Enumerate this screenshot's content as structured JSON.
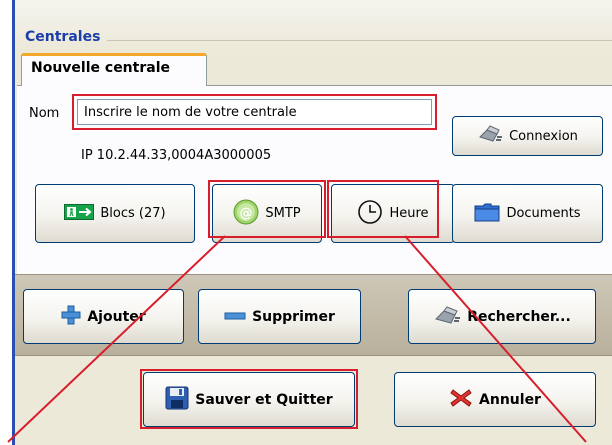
{
  "group": {
    "title": "Centrales"
  },
  "tab": {
    "label": "Nouvelle centrale"
  },
  "form": {
    "nom_label": "Nom",
    "nom_value": "Inscrire le nom de votre centrale",
    "ip_text": "IP 10.2.44.33,0004A3000005"
  },
  "buttons": {
    "connexion": "Connexion",
    "blocs": "Blocs (27)",
    "smtp": "SMTP",
    "heure": "Heure",
    "documents": "Documents",
    "ajouter": "Ajouter",
    "supprimer": "Supprimer",
    "rechercher": "Rechercher...",
    "sauver": "Sauver et Quitter",
    "annuler": "Annuler"
  },
  "colors": {
    "highlight": "#d81e2c",
    "title_blue": "#1c3ea8",
    "tab_accent": "#f3a72b"
  },
  "icons": {
    "connexion": "plug-icon",
    "blocs": "exit-sign-icon",
    "smtp": "email-at-icon",
    "heure": "clock-icon",
    "documents": "folder-icon",
    "ajouter": "plus-icon",
    "supprimer": "minus-icon",
    "rechercher": "plug-search-icon",
    "sauver": "floppy-disk-icon",
    "annuler": "red-x-icon"
  }
}
